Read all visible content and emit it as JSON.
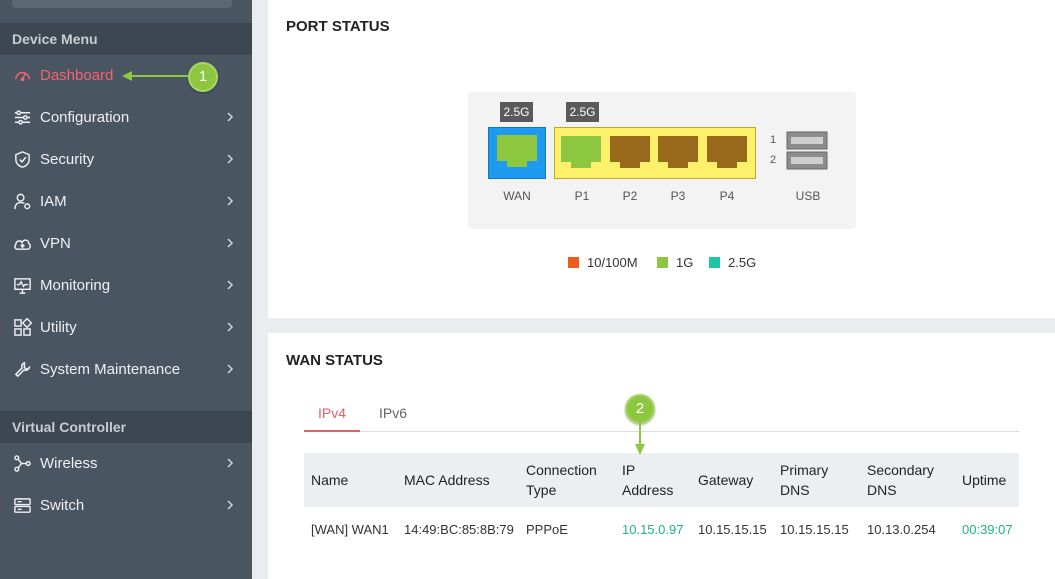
{
  "sidebar": {
    "device_menu_title": "Device Menu",
    "items": [
      {
        "label": "Dashboard",
        "icon": "dashboard-icon",
        "active": true
      },
      {
        "label": "Configuration",
        "icon": "sliders-icon"
      },
      {
        "label": "Security",
        "icon": "shield-icon"
      },
      {
        "label": "IAM",
        "icon": "user-gear-icon"
      },
      {
        "label": "VPN",
        "icon": "cloud-icon"
      },
      {
        "label": "Monitoring",
        "icon": "monitor-icon"
      },
      {
        "label": "Utility",
        "icon": "grid-icon"
      },
      {
        "label": "System Maintenance",
        "icon": "wrench-icon"
      }
    ],
    "virtual_controller_title": "Virtual Controller",
    "vc_items": [
      {
        "label": "Wireless",
        "icon": "network-icon"
      },
      {
        "label": "Switch",
        "icon": "switch-icon"
      }
    ]
  },
  "callouts": [
    "1",
    "2"
  ],
  "port_status": {
    "title": "PORT STATUS",
    "speed_tags": [
      "2.5G",
      "2.5G"
    ],
    "ports": [
      "WAN",
      "P1",
      "P2",
      "P3",
      "P4"
    ],
    "usb_numbers": [
      "1",
      "2"
    ],
    "usb_label": "USB",
    "legend": [
      {
        "label": "10/100M",
        "color": "#f05a1a"
      },
      {
        "label": "1G",
        "color": "#8dc63f"
      },
      {
        "label": "2.5G",
        "color": "#1fc6a6"
      }
    ]
  },
  "wan_status": {
    "title": "WAN STATUS",
    "tabs": [
      "IPv4",
      "IPv6"
    ],
    "columns": [
      "Name",
      "MAC Address",
      "Connection Type",
      "IP Address",
      "Gateway",
      "Primary DNS",
      "Secondary DNS",
      "Uptime"
    ],
    "columns_split": [
      [
        "Name"
      ],
      [
        "MAC Address"
      ],
      [
        "Connection",
        "Type"
      ],
      [
        "IP",
        "Address"
      ],
      [
        "Gateway"
      ],
      [
        "Primary",
        "DNS"
      ],
      [
        "Secondary",
        "DNS"
      ],
      [
        "Uptime"
      ]
    ],
    "row": [
      "[WAN] WAN1",
      "14:49:BC:85:8B:79",
      "PPPoE",
      "10.15.0.97",
      "10.15.15.15",
      "10.15.15.15",
      "10.13.0.254",
      "00:39:07"
    ]
  },
  "colors": {
    "sidebar_bg": "#4a5562",
    "active": "#f26470",
    "accent_green": "#22b08a",
    "wan_port": "#1e9bf0",
    "lan_group": "#fdf06a",
    "port_active": "#8dc63f",
    "port_inactive": "#9a6a1c"
  }
}
